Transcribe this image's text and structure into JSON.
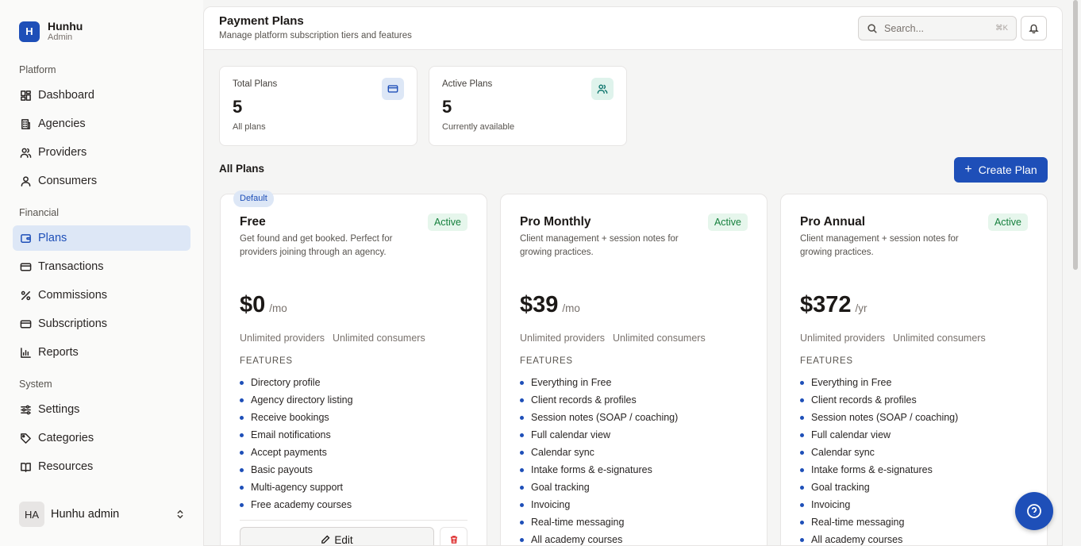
{
  "brand": {
    "logo_letter": "H",
    "name": "Hunhu",
    "role": "Admin"
  },
  "sidebar": {
    "sections": [
      {
        "heading": "Platform",
        "items": [
          {
            "label": "Dashboard",
            "icon": "dashboard-icon"
          },
          {
            "label": "Agencies",
            "icon": "building-icon"
          },
          {
            "label": "Providers",
            "icon": "users-icon"
          },
          {
            "label": "Consumers",
            "icon": "user-icon"
          }
        ]
      },
      {
        "heading": "Financial",
        "items": [
          {
            "label": "Plans",
            "icon": "wallet-icon",
            "active": true
          },
          {
            "label": "Transactions",
            "icon": "credit-card-icon"
          },
          {
            "label": "Commissions",
            "icon": "percent-icon"
          },
          {
            "label": "Subscriptions",
            "icon": "credit-card-icon"
          },
          {
            "label": "Reports",
            "icon": "bar-chart-icon"
          }
        ]
      },
      {
        "heading": "System",
        "items": [
          {
            "label": "Settings",
            "icon": "sliders-icon"
          },
          {
            "label": "Categories",
            "icon": "tag-icon"
          },
          {
            "label": "Resources",
            "icon": "book-icon"
          }
        ]
      }
    ],
    "user": {
      "initials": "HA",
      "name": "Hunhu admin"
    }
  },
  "header": {
    "title": "Payment Plans",
    "subtitle": "Manage platform subscription tiers and features",
    "search_placeholder": "Search...",
    "search_shortcut": "⌘K"
  },
  "stats": [
    {
      "label": "Total Plans",
      "value": "5",
      "note": "All plans",
      "icon": "credit-card-icon"
    },
    {
      "label": "Active Plans",
      "value": "5",
      "note": "Currently available",
      "icon": "users-icon"
    }
  ],
  "plans_section": {
    "title": "All Plans",
    "create_label": "Create Plan"
  },
  "plans": [
    {
      "default_badge": "Default",
      "name": "Free",
      "status": "Active",
      "description": "Get found and get booked. Perfect for providers joining through an agency.",
      "amount": "$0",
      "period": "/mo",
      "limits": [
        "Unlimited providers",
        "Unlimited consumers"
      ],
      "features_heading": "FEATURES",
      "features": [
        "Directory profile",
        "Agency directory listing",
        "Receive bookings",
        "Email notifications",
        "Accept payments",
        "Basic payouts",
        "Multi-agency support",
        "Free academy courses"
      ],
      "edit_label": "Edit"
    },
    {
      "name": "Pro Monthly",
      "status": "Active",
      "description": "Client management + session notes for growing practices.",
      "amount": "$39",
      "period": "/mo",
      "limits": [
        "Unlimited providers",
        "Unlimited consumers"
      ],
      "features_heading": "FEATURES",
      "features": [
        "Everything in Free",
        "Client records & profiles",
        "Session notes (SOAP / coaching)",
        "Full calendar view",
        "Calendar sync",
        "Intake forms & e-signatures",
        "Goal tracking",
        "Invoicing",
        "Real-time messaging",
        "All academy courses"
      ]
    },
    {
      "name": "Pro Annual",
      "status": "Active",
      "description": "Client management + session notes for growing practices.",
      "amount": "$372",
      "period": "/yr",
      "limits": [
        "Unlimited providers",
        "Unlimited consumers"
      ],
      "features_heading": "FEATURES",
      "features": [
        "Everything in Free",
        "Client records & profiles",
        "Session notes (SOAP / coaching)",
        "Full calendar view",
        "Calendar sync",
        "Intake forms & e-signatures",
        "Goal tracking",
        "Invoicing",
        "Real-time messaging",
        "All academy courses"
      ]
    }
  ],
  "colors": {
    "accent": "#1e4fb8",
    "active_bg": "#dde7f6",
    "status_green": "#15803d",
    "danger": "#dc2626"
  }
}
